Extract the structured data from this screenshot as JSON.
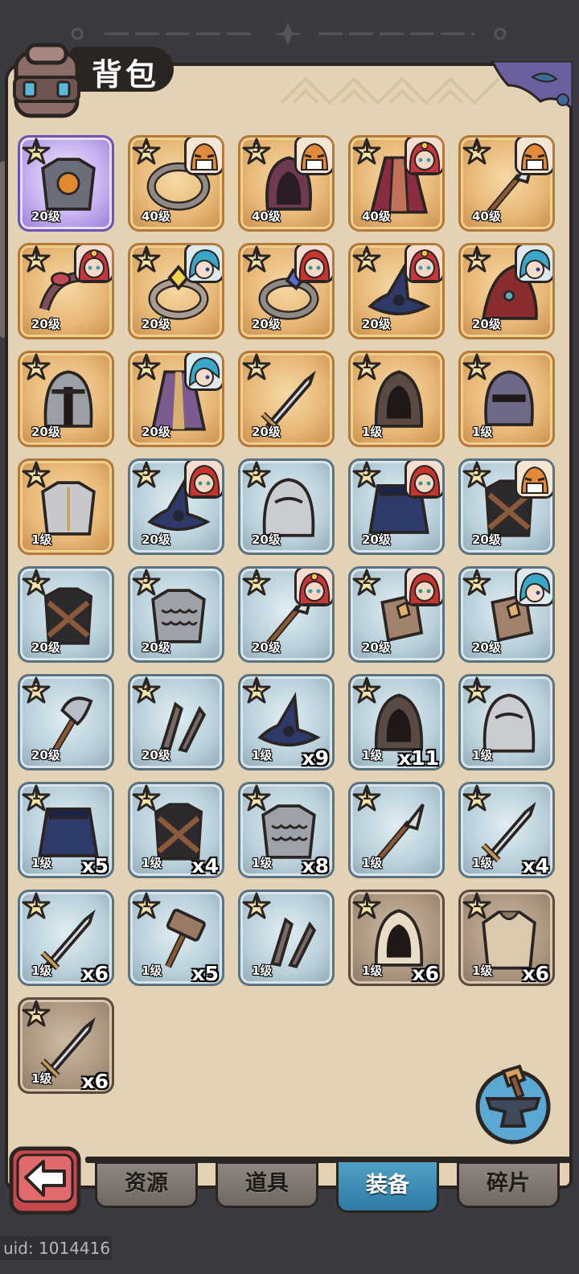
{
  "header": {
    "title": "背包"
  },
  "colors": {
    "gold": "#e8b978",
    "purple": "#c8b2ef",
    "blue": "#b8cfd9",
    "brown": "#ab9680",
    "active_tab": "#3b8cb6"
  },
  "items": [
    {
      "stars": "1",
      "level": "20级",
      "rarity": "purple",
      "icon": "armor-chestplate-icon",
      "hero": null,
      "count": null
    },
    {
      "stars": "2",
      "level": "40级",
      "rarity": "gold",
      "icon": "ring-icon",
      "hero": "tiger-hero-icon",
      "count": null
    },
    {
      "stars": "3",
      "level": "40级",
      "rarity": "gold",
      "icon": "hood-icon",
      "hero": "tiger-hero-icon",
      "count": null
    },
    {
      "stars": "1",
      "level": "40级",
      "rarity": "gold",
      "icon": "cloak-icon",
      "hero": "red-hair-hero-icon",
      "count": null
    },
    {
      "stars": "4",
      "level": "40级",
      "rarity": "gold",
      "icon": "spear-icon",
      "hero": "tiger-hero-icon",
      "count": null
    },
    {
      "stars": "1",
      "level": "20级",
      "rarity": "gold",
      "icon": "bracelet-icon",
      "hero": "red-hair-hero-icon",
      "count": null
    },
    {
      "stars": "1",
      "level": "20级",
      "rarity": "gold",
      "icon": "gem-ring-icon",
      "hero": "blue-hair-hero-icon",
      "count": null
    },
    {
      "stars": "1",
      "level": "20级",
      "rarity": "gold",
      "icon": "sapphire-ring-icon",
      "hero": "red-girl-hero-icon",
      "count": null
    },
    {
      "stars": "2",
      "level": "20级",
      "rarity": "gold",
      "icon": "wizard-hat-icon",
      "hero": "red-hair-hero-icon",
      "count": null
    },
    {
      "stars": "1",
      "level": "20级",
      "rarity": "gold",
      "icon": "red-hood-icon",
      "hero": "blue-hair-hero-icon",
      "count": null
    },
    {
      "stars": "1",
      "level": "20级",
      "rarity": "gold",
      "icon": "helmet-icon",
      "hero": null,
      "count": null
    },
    {
      "stars": "1",
      "level": "20级",
      "rarity": "gold",
      "icon": "robe-icon",
      "hero": "blue-hair-hero-icon",
      "count": null
    },
    {
      "stars": "1",
      "level": "20级",
      "rarity": "gold",
      "icon": "sword-icon",
      "hero": null,
      "count": null
    },
    {
      "stars": "1",
      "level": "1级",
      "rarity": "gold",
      "icon": "dark-hood-icon",
      "hero": null,
      "count": null
    },
    {
      "stars": "1",
      "level": "1级",
      "rarity": "gold",
      "icon": "knight-helmet-icon",
      "hero": null,
      "count": null
    },
    {
      "stars": "1",
      "level": "1级",
      "rarity": "gold",
      "icon": "plate-armor-icon",
      "hero": null,
      "count": null
    },
    {
      "stars": "5",
      "level": "20级",
      "rarity": "blue",
      "icon": "wizard-hat-icon",
      "hero": "red-girl-hero-icon",
      "count": null
    },
    {
      "stars": "5",
      "level": "20级",
      "rarity": "blue",
      "icon": "steel-helmet-icon",
      "hero": null,
      "count": null
    },
    {
      "stars": "5",
      "level": "20级",
      "rarity": "blue",
      "icon": "cape-icon",
      "hero": "red-girl-hero-icon",
      "count": null
    },
    {
      "stars": "5",
      "level": "20级",
      "rarity": "blue",
      "icon": "leather-vest-icon",
      "hero": "tiger-hero-icon",
      "count": null
    },
    {
      "stars": "4",
      "level": "20级",
      "rarity": "blue",
      "icon": "leather-vest-icon",
      "hero": null,
      "count": null
    },
    {
      "stars": "5",
      "level": "20级",
      "rarity": "blue",
      "icon": "scale-armor-icon",
      "hero": null,
      "count": null
    },
    {
      "stars": "5",
      "level": "20级",
      "rarity": "blue",
      "icon": "spear-icon",
      "hero": "red-hair-hero-icon",
      "count": null
    },
    {
      "stars": "2",
      "level": "20级",
      "rarity": "blue",
      "icon": "bracer-icon",
      "hero": "red-girl-hero-icon",
      "count": null
    },
    {
      "stars": "5",
      "level": "20级",
      "rarity": "blue",
      "icon": "bracer-icon",
      "hero": "blue-hair-hero-icon",
      "count": null
    },
    {
      "stars": "5",
      "level": "20级",
      "rarity": "blue",
      "icon": "axe-icon",
      "hero": null,
      "count": null
    },
    {
      "stars": "4",
      "level": "20级",
      "rarity": "blue",
      "icon": "daggers-icon",
      "hero": null,
      "count": null
    },
    {
      "stars": "1",
      "level": "1级",
      "rarity": "blue",
      "icon": "wizard-hat-icon",
      "hero": null,
      "count": "x9"
    },
    {
      "stars": "1",
      "level": "1级",
      "rarity": "blue",
      "icon": "dark-hood-icon",
      "hero": null,
      "count": "x11"
    },
    {
      "stars": "1",
      "level": "1级",
      "rarity": "blue",
      "icon": "steel-helmet-icon",
      "hero": null,
      "count": null
    },
    {
      "stars": "1",
      "level": "1级",
      "rarity": "blue",
      "icon": "cape-icon",
      "hero": null,
      "count": "x5"
    },
    {
      "stars": "1",
      "level": "1级",
      "rarity": "blue",
      "icon": "leather-vest-icon",
      "hero": null,
      "count": "x4"
    },
    {
      "stars": "1",
      "level": "1级",
      "rarity": "blue",
      "icon": "scale-armor-icon",
      "hero": null,
      "count": "x8"
    },
    {
      "stars": "1",
      "level": "1级",
      "rarity": "blue",
      "icon": "spear-icon",
      "hero": null,
      "count": null
    },
    {
      "stars": "1",
      "level": "1级",
      "rarity": "blue",
      "icon": "sword-icon",
      "hero": null,
      "count": "x4"
    },
    {
      "stars": "1",
      "level": "1级",
      "rarity": "blue",
      "icon": "sword-icon",
      "hero": null,
      "count": "x6"
    },
    {
      "stars": "1",
      "level": "1级",
      "rarity": "blue",
      "icon": "hammer-icon",
      "hero": null,
      "count": "x5"
    },
    {
      "stars": "1",
      "level": "1级",
      "rarity": "blue",
      "icon": "daggers-icon",
      "hero": null,
      "count": null
    },
    {
      "stars": "1",
      "level": "1级",
      "rarity": "brown",
      "icon": "cloth-hood-icon",
      "hero": null,
      "count": "x6"
    },
    {
      "stars": "1",
      "level": "1级",
      "rarity": "brown",
      "icon": "cloth-shirt-icon",
      "hero": null,
      "count": "x6"
    },
    {
      "stars": "1",
      "level": "1级",
      "rarity": "brown",
      "icon": "sword-icon",
      "hero": null,
      "count": "x6"
    }
  ],
  "tabs": [
    {
      "label": "资源",
      "active": false
    },
    {
      "label": "道具",
      "active": false
    },
    {
      "label": "装备",
      "active": true
    },
    {
      "label": "碎片",
      "active": false
    }
  ],
  "footer": {
    "uid": "uid: 1014416"
  }
}
